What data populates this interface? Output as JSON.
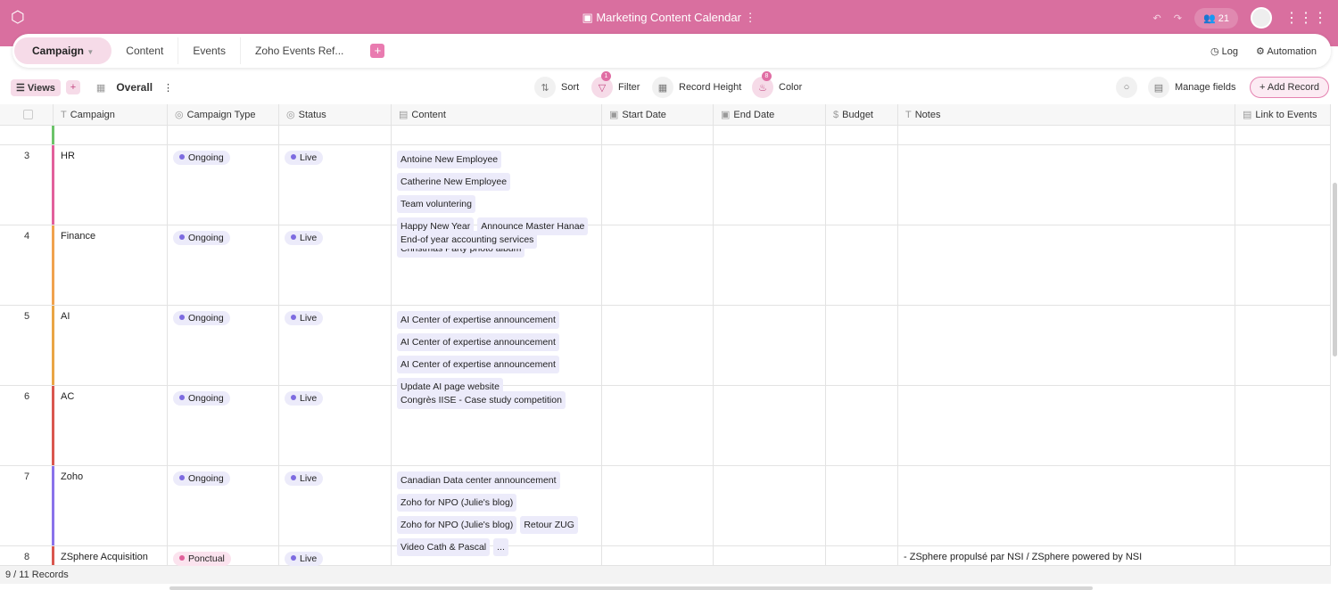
{
  "app": {
    "title": "Marketing Content Calendar",
    "users_count": "21",
    "accent": "#d96f9f"
  },
  "tabs": [
    {
      "label": "Campaign",
      "active": true
    },
    {
      "label": "Content"
    },
    {
      "label": "Events"
    },
    {
      "label": "Zoho Events Ref..."
    }
  ],
  "tab_actions": {
    "log": "Log",
    "automation": "Automation"
  },
  "toolbar": {
    "views": "Views",
    "view_name": "Overall",
    "sort": "Sort",
    "filter": "Filter",
    "filter_count": "1",
    "record_height": "Record Height",
    "color": "Color",
    "color_count": "8",
    "manage_fields": "Manage fields",
    "add_record": "+ Add Record"
  },
  "columns": [
    "Campaign",
    "Campaign Type",
    "Status",
    "Content",
    "Start Date",
    "End Date",
    "Budget",
    "Notes",
    "Link to Events"
  ],
  "rows": [
    {
      "num": "",
      "campaign": "",
      "bar": "#6cc36a",
      "type": "",
      "status": "",
      "content": [],
      "notes": ""
    },
    {
      "num": "3",
      "campaign": "HR",
      "bar": "#e2609c",
      "type": "Ongoing",
      "status": "Live",
      "content": [
        "Antoine New Employee",
        "Catherine New Employee",
        "Team voluntering",
        "Happy New Year",
        "Announce Master Hanae",
        "Christmas Party photo album"
      ],
      "notes": ""
    },
    {
      "num": "4",
      "campaign": "Finance",
      "bar": "#f0a24e",
      "type": "Ongoing",
      "status": "Live",
      "content": [
        "End-of year accounting services"
      ],
      "notes": ""
    },
    {
      "num": "5",
      "campaign": "AI",
      "bar": "#e9a545",
      "type": "Ongoing",
      "status": "Live",
      "content": [
        "AI Center of expertise announcement",
        "AI Center of expertise announcement",
        "AI Center of expertise announcement",
        "Update AI page website"
      ],
      "notes": ""
    },
    {
      "num": "6",
      "campaign": "AC",
      "bar": "#d9574f",
      "type": "Ongoing",
      "status": "Live",
      "content": [
        "Congrès IISE - Case study competition"
      ],
      "notes": ""
    },
    {
      "num": "7",
      "campaign": "Zoho",
      "bar": "#8a72ea",
      "type": "Ongoing",
      "status": "Live",
      "content": [
        "Canadian Data center announcement",
        "Zoho for NPO (Julie's blog)",
        "Zoho for NPO (Julie's blog)",
        "Retour ZUG",
        "Video Cath & Pascal",
        "..."
      ],
      "notes": ""
    },
    {
      "num": "8",
      "campaign": "ZSphere Acquisition",
      "bar": "#d9574f",
      "type": "Ponctual",
      "status": "Live",
      "content": [],
      "notes": "- ZSphere propulsé par NSI / ZSphere powered by NSI"
    }
  ],
  "type_colors": {
    "Ongoing": {
      "bg": "#ecebfa",
      "dot": "#7d6be0"
    },
    "Ponctual": {
      "bg": "#fbe3ee",
      "dot": "#e0609a"
    }
  },
  "footer": {
    "records": "9 / 11 Records"
  }
}
